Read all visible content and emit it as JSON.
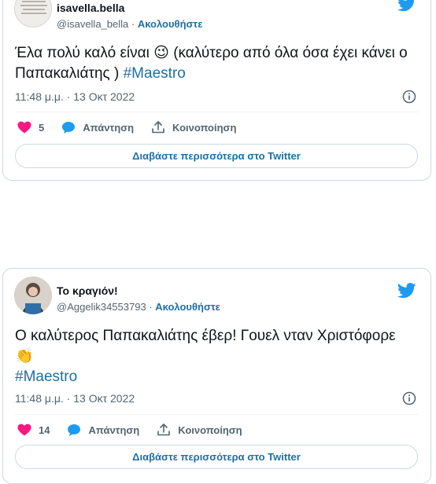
{
  "colors": {
    "twitter_blue": "#1d9bf0",
    "link_blue": "#1d6fa5",
    "heart": "#f91880",
    "muted": "#536471",
    "border": "#cfd9de"
  },
  "tweets": [
    {
      "display_name": "isavella.bella",
      "handle": "@isavella_bella",
      "separator": " · ",
      "follow_label": "Ακολουθήστε",
      "text": "Έλα πολύ καλό είναι 😉 (καλύτερο από όλα όσα έχει κάνει ο Παπακαλιάτης )",
      "hashtag": "#Maestro",
      "timestamp": "11:48 μ.μ. · 13 Οκτ 2022",
      "likes": "5",
      "reply_label": "Απάντηση",
      "share_label": "Κοινοποίηση",
      "read_more_label": "Διαβάστε περισσότερα στο Twitter",
      "icons": [
        "twitter-bird-icon",
        "info-icon",
        "heart-icon",
        "reply-bubble-icon",
        "share-icon"
      ]
    },
    {
      "display_name": "Το κραγιόν!",
      "handle": "@Aggelik34553793",
      "separator": " · ",
      "follow_label": "Ακολουθήστε",
      "text": "Ο καλύτερος Παπακαλιάτης έβερ! Γουελ νταν Χριστόφορε 👏",
      "hashtag": "#Maestro",
      "timestamp": "11:48 μ.μ. · 13 Οκτ 2022",
      "likes": "14",
      "reply_label": "Απάντηση",
      "share_label": "Κοινοποίηση",
      "read_more_label": "Διαβάστε περισσότερα στο Twitter",
      "icons": [
        "twitter-bird-icon",
        "info-icon",
        "heart-icon",
        "reply-bubble-icon",
        "share-icon"
      ]
    }
  ]
}
